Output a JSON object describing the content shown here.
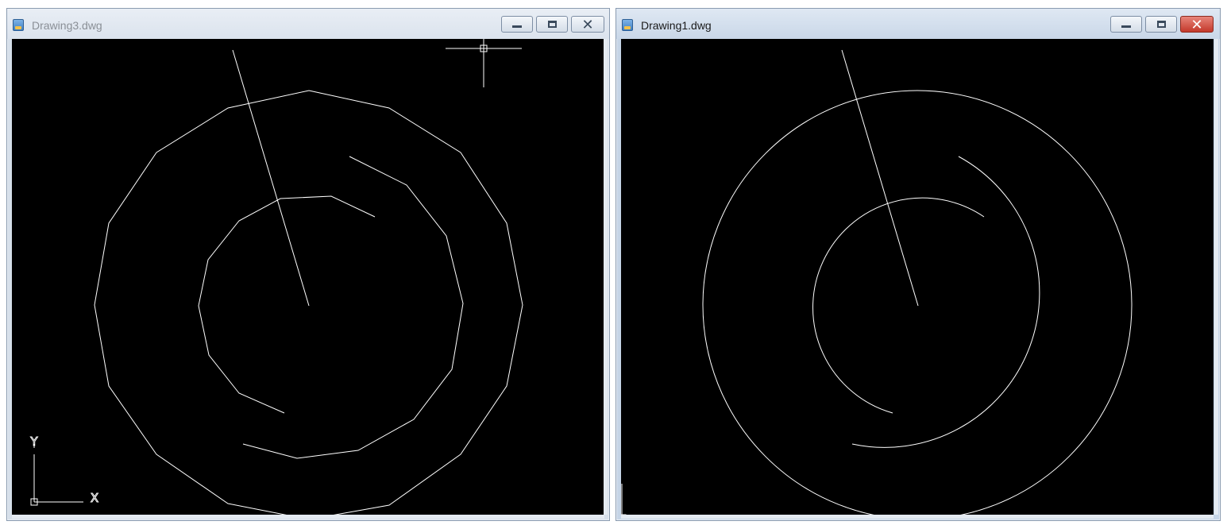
{
  "windows": [
    {
      "id": "drawing3",
      "title": "Drawing3.dwg",
      "active": false,
      "controls": {
        "minimize": "minimize",
        "maximize": "maximize",
        "close": "close"
      },
      "ucs": {
        "x_label": "X",
        "y_label": "Y"
      }
    },
    {
      "id": "drawing1",
      "title": "Drawing1.dwg",
      "active": true,
      "controls": {
        "minimize": "minimize",
        "maximize": "maximize",
        "close": "close"
      }
    }
  ],
  "colors": {
    "canvas_background": "#000000",
    "geometry_stroke": "#ffffff",
    "close_button_active": "#c3392b"
  },
  "icons": [
    "app-icon",
    "minimize-icon",
    "maximize-icon",
    "close-icon",
    "crosshair-cursor-icon",
    "ucs-icon"
  ]
}
